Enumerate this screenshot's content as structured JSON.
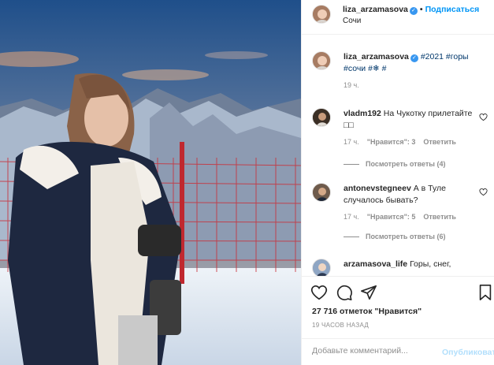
{
  "post": {
    "username": "liza_arzamasova",
    "follow_label": "Подписаться",
    "dot": "•",
    "location": "Сочи"
  },
  "caption": {
    "username": "liza_arzamasova",
    "text": "#2021 #горы #сочи #❄ #",
    "time": "19 ч."
  },
  "comments": [
    {
      "username": "vladm192",
      "text": "На Чукотку прилетайте ",
      "time": "17 ч.",
      "likes": "\"Нравится\": 3",
      "reply": "Ответить",
      "view_replies": "Посмотреть ответы (4)"
    },
    {
      "username": "antonevstegneev",
      "text": "А в Туле случалось бывать?",
      "time": "17 ч.",
      "likes": "\"Нравится\": 5",
      "reply": "Ответить",
      "view_replies": "Посмотреть ответы (6)"
    },
    {
      "username": "arzamasova_life",
      "text": "Горы, снег,"
    }
  ],
  "stats": {
    "likes_text": "27 716 отметок \"Нравится\"",
    "time_ago": "19 ЧАСОВ НАЗАД"
  },
  "composer": {
    "placeholder": "Добавьте комментарий...",
    "publish_label": "Опубликовать"
  },
  "icons": {
    "like": "heart-icon",
    "comment": "comment-icon",
    "share": "share-icon",
    "save": "bookmark-icon",
    "verified": "verified-badge-icon"
  },
  "colors": {
    "accent": "#0095f6",
    "verified": "#3897f0",
    "hashtag": "#00376b",
    "muted": "#8e8e8e"
  }
}
